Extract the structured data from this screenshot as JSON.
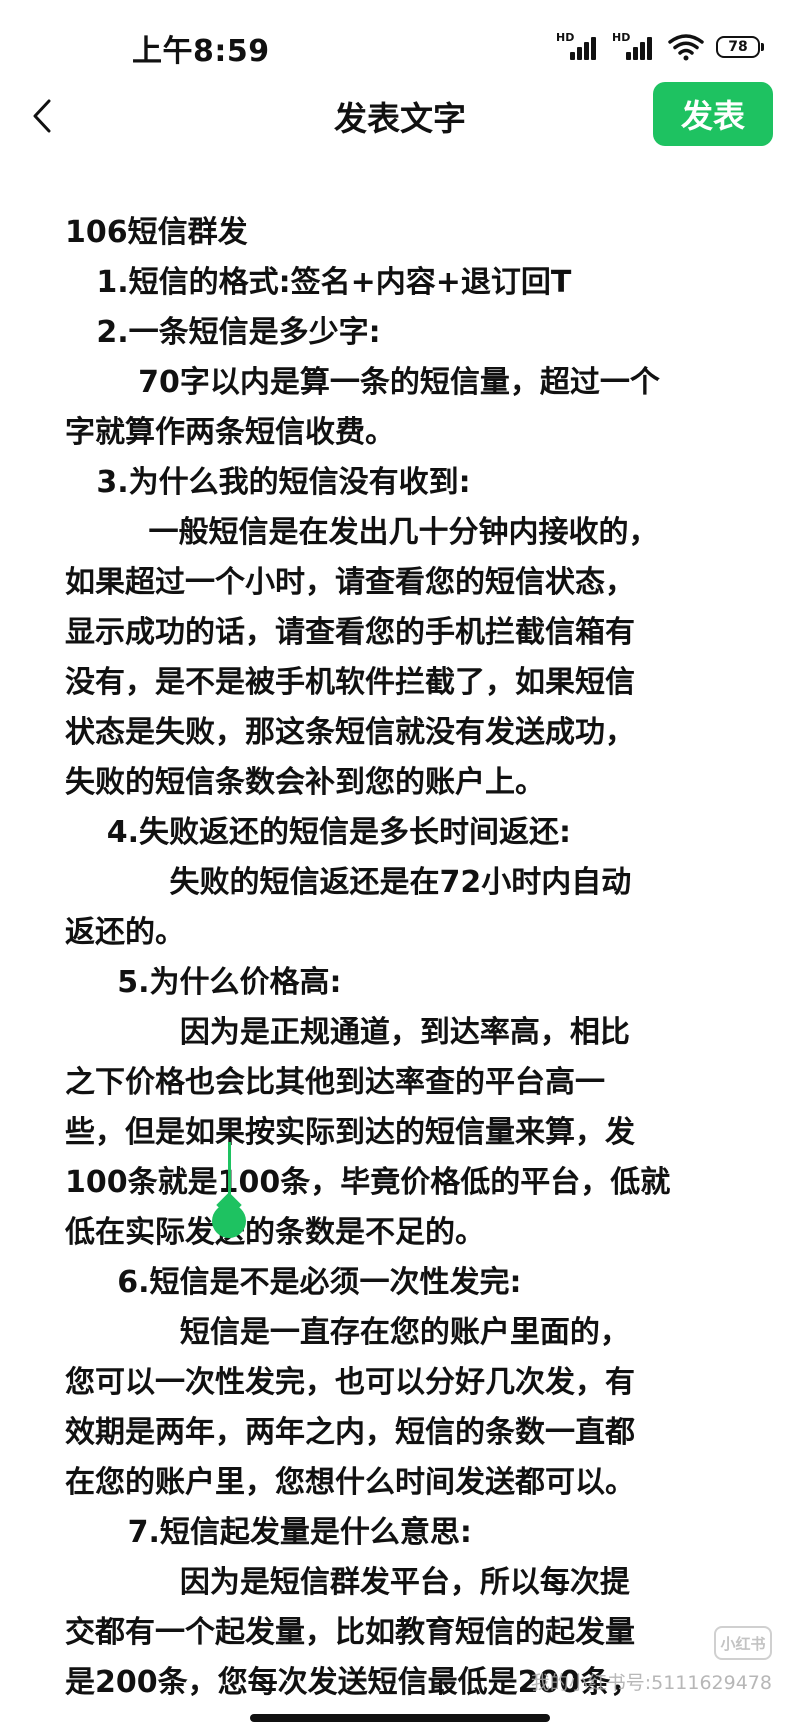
{
  "status_bar": {
    "time": "上午8:59",
    "signal_label_1": "HD",
    "signal_label_2": "HD",
    "battery": "78"
  },
  "header": {
    "title": "发表文字",
    "publish_label": "发表",
    "back_icon": "chevron-left-icon"
  },
  "editor": {
    "lines": [
      "106短信群发",
      "   1.短信的格式:签名+内容+退订回T",
      "   2.一条短信是多少字:",
      "       70字以内是算一条的短信量，超过一个",
      "字就算作两条短信收费。",
      "   3.为什么我的短信没有收到:",
      "        一般短信是在发出几十分钟内接收的，",
      "如果超过一个小时，请查看您的短信状态，",
      "显示成功的话，请查看您的手机拦截信箱有",
      "没有，是不是被手机软件拦截了，如果短信",
      "状态是失败，那这条短信就没有发送成功，",
      "失败的短信条数会补到您的账户上。",
      "    4.失败返还的短信是多长时间返还:",
      "          失败的短信返还是在72小时内自动",
      "返还的。",
      "     5.为什么价格高:",
      "           因为是正规通道，到达率高，相比",
      "之下价格也会比其他到达率查的平台高一",
      "些，但是如果按实际到达的短信量来算，发",
      "100条就是100条，毕竟价格低的平台，低就",
      "低在实际发送的条数是不足的。",
      "     6.短信是不是必须一次性发完:",
      "           短信是一直存在您的账户里面的，",
      "您可以一次性发完，也可以分好几次发，有",
      "效期是两年，两年之内，短信的条数一直都",
      "在您的账户里，您想什么时间发送都可以。",
      "      7.短信起发量是什么意思:",
      "           因为是短信群发平台，所以每次提",
      "交都有一个起发量，比如教育短信的起发量",
      "是200条，您每次发送短信最低是200条，"
    ]
  },
  "watermark": {
    "logo": "小红书",
    "text": "我的小红书号:5111629478"
  },
  "colors": {
    "accent": "#1ec261",
    "text": "#111111",
    "background": "#ffffff"
  }
}
